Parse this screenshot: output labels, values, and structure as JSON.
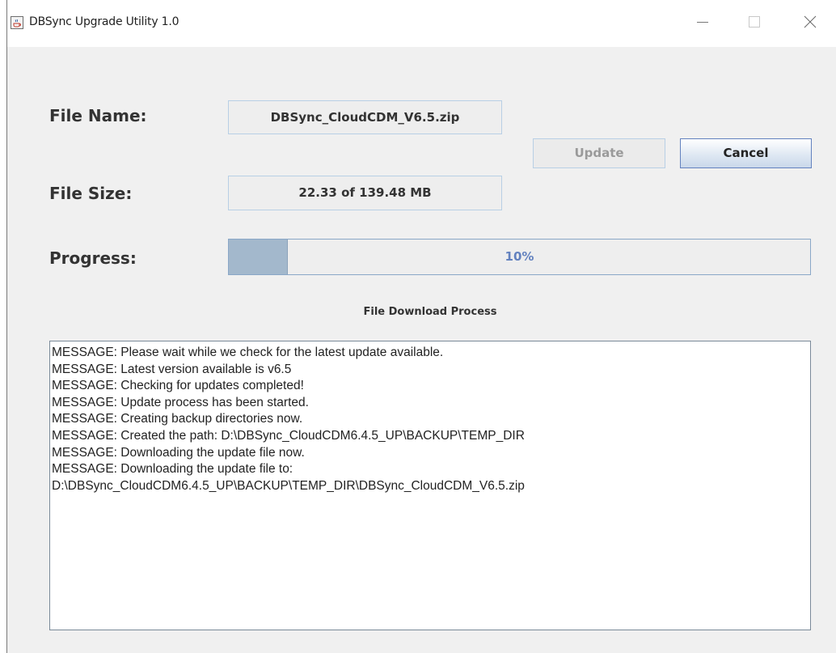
{
  "window": {
    "title": "DBSync Upgrade Utility 1.0",
    "icons": {
      "app": "java-cup-icon",
      "minimize": "minimize-icon",
      "maximize": "maximize-icon",
      "close": "close-icon"
    }
  },
  "fields": {
    "file_name_label": "File Name:",
    "file_name_value": "DBSync_CloudCDM_V6.5.zip",
    "file_size_label": "File Size:",
    "file_size_value": "22.33 of 139.48 MB",
    "progress_label": "Progress:"
  },
  "progress": {
    "percent": 10,
    "text": "10%",
    "fill_color": "#a3b8cc",
    "text_color": "#6382bf"
  },
  "buttons": {
    "update_label": "Update",
    "update_enabled": false,
    "cancel_label": "Cancel"
  },
  "log": {
    "title": "File Download Process",
    "lines": [
      "MESSAGE: Please wait while we check for the latest update available.",
      "MESSAGE: Latest version available is v6.5",
      "MESSAGE: Checking for updates completed!",
      "MESSAGE: Update process has been started.",
      "MESSAGE: Creating backup directories now.",
      "MESSAGE: Created the path: D:\\DBSync_CloudCDM6.4.5_UP\\BACKUP\\TEMP_DIR",
      "MESSAGE: Downloading the update file now.",
      "MESSAGE: Downloading the update file to:",
      "D:\\DBSync_CloudCDM6.4.5_UP\\BACKUP\\TEMP_DIR\\DBSync_CloudCDM_V6.5.zip"
    ]
  }
}
